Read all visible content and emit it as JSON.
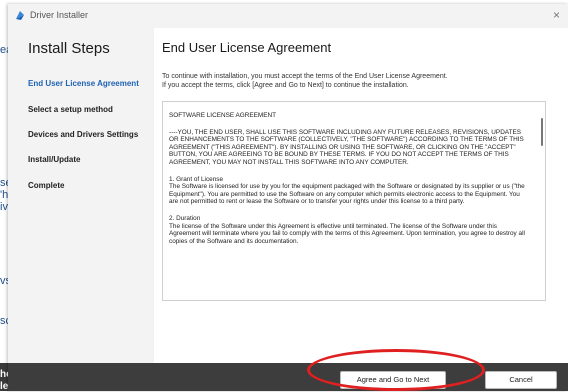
{
  "background_fragments": [
    "ea",
    "se",
    "'h",
    "iv",
    "vs",
    "sc",
    "he",
    "le"
  ],
  "window": {
    "title": "Driver Installer",
    "close_glyph": "×"
  },
  "sidebar": {
    "title": "Install Steps",
    "steps": [
      {
        "label": "End User License Agreement",
        "active": true
      },
      {
        "label": "Select a setup method",
        "active": false
      },
      {
        "label": "Devices and Drivers Settings",
        "active": false
      },
      {
        "label": "Install/Update",
        "active": false
      },
      {
        "label": "Complete",
        "active": false
      }
    ]
  },
  "content": {
    "title": "End User License Agreement",
    "intro_line1": "To continue with installation, you must accept the terms of the End User License Agreement.",
    "intro_line2": "If you accept the terms, click [Agree and Go to Next] to continue the installation."
  },
  "license": {
    "heading": "SOFTWARE LICENSE AGREEMENT",
    "para1": "----YOU, THE END USER, SHALL USE THIS SOFTWARE INCLUDING ANY FUTURE RELEASES, REVISIONS, UPDATES OR ENHANCEMENTS TO THE SOFTWARE (COLLECTIVELY, \"THE SOFTWARE\") ACCORDING TO THE TERMS OF THIS AGREEMENT (\"THIS AGREEMENT\"). BY INSTALLING OR USING THE SOFTWARE, OR CLICKING ON THE \"ACCEPT\" BUTTON, YOU ARE AGREEING TO BE BOUND BY THESE TERMS. IF YOU DO NOT ACCEPT THE TERMS OF THIS AGREEMENT, YOU MAY NOT INSTALL THIS SOFTWARE INTO ANY COMPUTER.",
    "sec1_title": "1. Grant of License",
    "sec1_body": "The Software is licensed for use by you for the equipment packaged with the Software or designated by its supplier or us (\"the Equipment\"). You are permitted to use the Software on any computer which permits electronic access to the Equipment. You are not permitted to rent or lease the Software or to transfer your rights under this license to a third party.",
    "sec2_title": "2. Duration",
    "sec2_body": "The license of the Software under this Agreement is effective until terminated. The license of the Software under this Agreement will terminate where you fail to comply with the terms of this Agreement. Upon termination, you agree to destroy all copies of the Software and its documentation."
  },
  "buttons": {
    "agree": "Agree and Go to Next",
    "cancel": "Cancel"
  },
  "colors": {
    "accent": "#1e62b4",
    "highlight": "#e02020"
  }
}
